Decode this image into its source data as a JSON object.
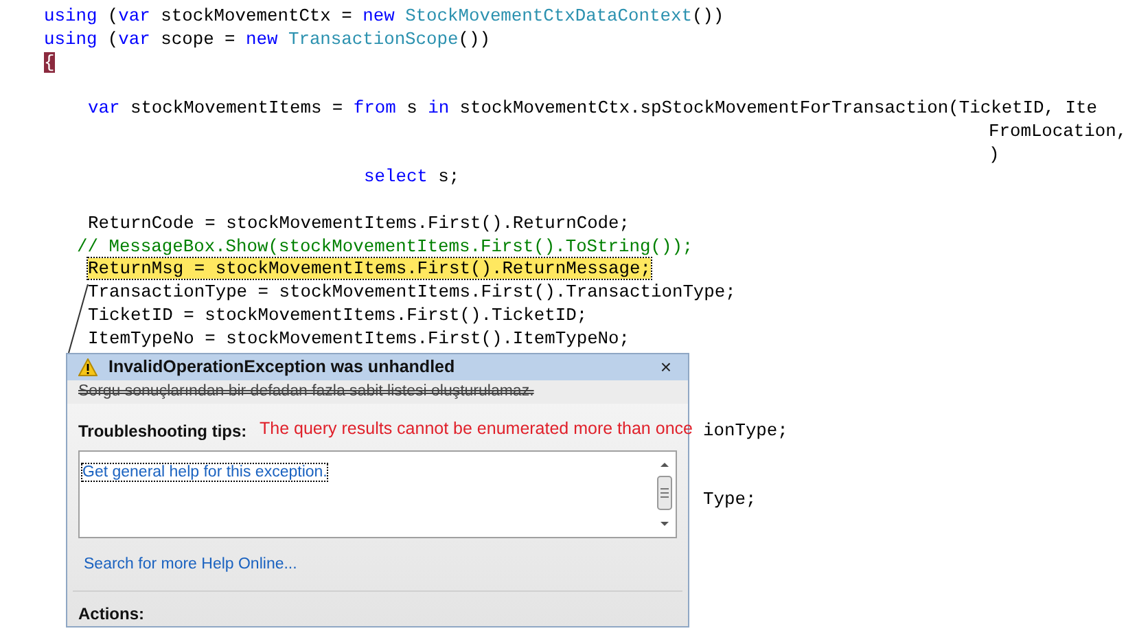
{
  "code_lines": [
    {
      "kind": "outer",
      "segments": [
        {
          "kind": "keyword",
          "text": "using"
        },
        {
          "kind": "plain",
          "text": " ("
        },
        {
          "kind": "keyword",
          "text": "var"
        },
        {
          "kind": "plain",
          "text": " stockMovementCtx = "
        },
        {
          "kind": "keyword",
          "text": "new"
        },
        {
          "kind": "type",
          "text": " StockMovementCtxDataContext"
        },
        {
          "kind": "plain",
          "text": "())"
        }
      ]
    },
    {
      "kind": "outer",
      "segments": [
        {
          "kind": "keyword",
          "text": "using"
        },
        {
          "kind": "plain",
          "text": " ("
        },
        {
          "kind": "keyword",
          "text": "var"
        },
        {
          "kind": "plain",
          "text": " scope = "
        },
        {
          "kind": "keyword",
          "text": "new"
        },
        {
          "kind": "type",
          "text": " TransactionScope"
        },
        {
          "kind": "plain",
          "text": "())"
        }
      ]
    },
    {
      "kind": "outer",
      "segments": [
        {
          "kind": "brace",
          "text": "{"
        }
      ]
    },
    {
      "kind": "blank"
    },
    {
      "kind": "body",
      "segments": [
        {
          "kind": "keyword",
          "text": "var"
        },
        {
          "kind": "plain",
          "text": " stockMovementItems = "
        },
        {
          "kind": "keyword",
          "text": "from"
        },
        {
          "kind": "plain",
          "text": " s "
        },
        {
          "kind": "keyword",
          "text": "in"
        },
        {
          "kind": "plain",
          "text": " stockMovementCtx.spStockMovementForTransaction(TicketID, Ite"
        }
      ]
    },
    {
      "kind": "continuation",
      "segments": [
        {
          "kind": "plain",
          "text": "FromLocation,"
        }
      ]
    },
    {
      "kind": "continuation",
      "segments": [
        {
          "kind": "plain",
          "text": ")"
        }
      ]
    },
    {
      "kind": "select",
      "segments": [
        {
          "kind": "keyword",
          "text": "select"
        },
        {
          "kind": "plain",
          "text": " s;"
        }
      ]
    },
    {
      "kind": "blank"
    },
    {
      "kind": "body",
      "segments": [
        {
          "kind": "plain",
          "text": "ReturnCode = stockMovementItems.First().ReturnCode;"
        }
      ]
    },
    {
      "kind": "comment",
      "segments": [
        {
          "kind": "comment",
          "text": "// MessageBox.Show(stockMovementItems.First().ToString());"
        }
      ]
    },
    {
      "kind": "body",
      "highlighted": true,
      "segments": [
        {
          "kind": "plain",
          "text": "ReturnMsg = stockMovementItems.First().ReturnMessage;"
        }
      ]
    },
    {
      "kind": "body",
      "segments": [
        {
          "kind": "plain",
          "text": "TransactionType = stockMovementItems.First().TransactionType;"
        }
      ]
    },
    {
      "kind": "body",
      "segments": [
        {
          "kind": "plain",
          "text": "TicketID = stockMovementItems.First().TicketID;"
        }
      ]
    },
    {
      "kind": "body",
      "segments": [
        {
          "kind": "plain",
          "text": "ItemTypeNo = stockMovementItems.First().ItemTypeNo;"
        }
      ]
    },
    {
      "kind": "blank"
    },
    {
      "kind": "blank"
    },
    {
      "kind": "blank"
    },
    {
      "kind": "fragment",
      "segments": [
        {
          "kind": "plain",
          "text": "ionType;"
        }
      ]
    },
    {
      "kind": "blank"
    },
    {
      "kind": "blank"
    },
    {
      "kind": "fragment",
      "segments": [
        {
          "kind": "plain",
          "text": "Type;"
        }
      ]
    }
  ],
  "dialog": {
    "title": "InvalidOperationException was unhandled",
    "close": "×",
    "message": "Sorgu sonuçlarından bir defadan fazla sabit listesi oluşturulamaz.",
    "message_scribbled": true,
    "tips_label": "Troubleshooting tips:",
    "tips": [
      "Get general help for this exception."
    ],
    "search_link": "Search for more Help Online...",
    "actions_label": "Actions:"
  },
  "annotation": "The query results cannot be enumerated more than once"
}
